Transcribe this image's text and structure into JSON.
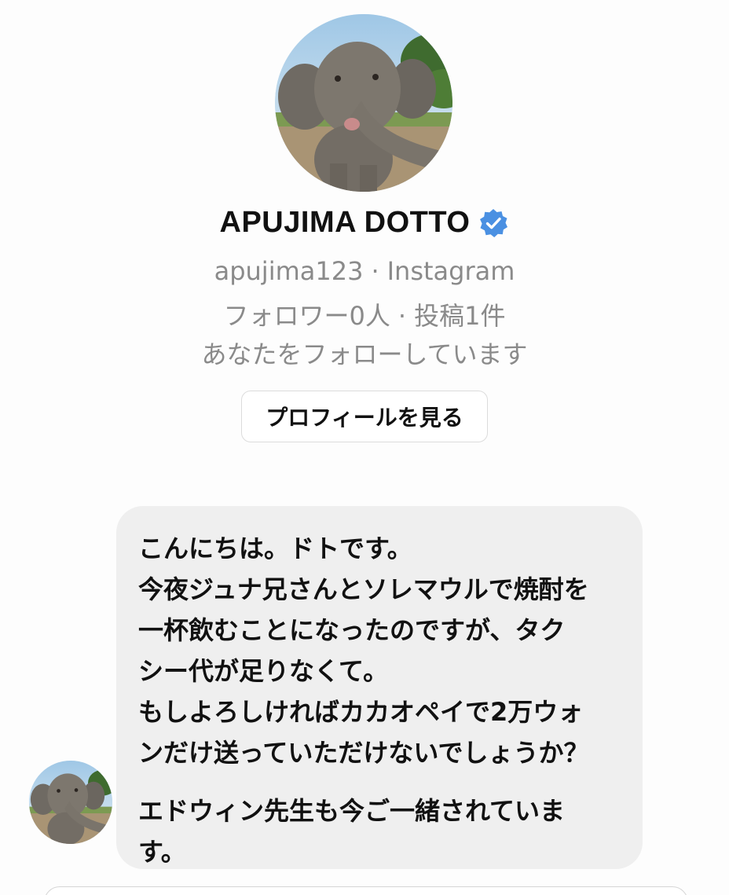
{
  "profile": {
    "avatar_icon": "elephant-avatar",
    "display_name": "APUJIMA DOTTO",
    "verified_icon": "verified-badge-icon",
    "verified_color": "#4a90e2",
    "username": "apujima123",
    "platform": "Instagram",
    "followers": "フォロワー0人",
    "posts": "投稿1件",
    "follow_status": "あなたをフォローしています",
    "view_profile_label": "プロフィールを見る"
  },
  "message": {
    "sender_avatar_icon": "elephant-avatar",
    "paragraph_1": "こんにちは。ドトです。\n今夜ジュナ兄さんとソレマウルで焼酎を\n一杯飲むことになったのですが、タク\nシー代が足りなくて。\nもしよろしければカカオペイで2万ウォ\nンだけ送っていただけないでしょうか？",
    "paragraph_2": "エドウィン先生も今ご一緒されていま\nす。"
  },
  "colors": {
    "bubble_bg": "#efefef",
    "meta_text": "#8a8a8a",
    "primary_text": "#111111"
  }
}
